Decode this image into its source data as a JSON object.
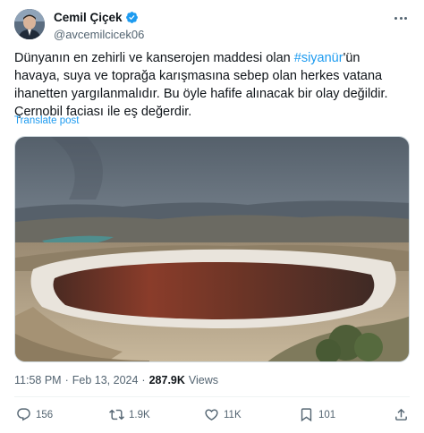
{
  "author": {
    "display_name": "Cemil Çiçek",
    "handle": "@avcemilcicek06",
    "verified": true
  },
  "tweet": {
    "text_before": "Dünyanın en zehirli ve kanserojen maddesi olan ",
    "hashtag": "#siyanür",
    "text_after": "'ün havaya, suya ve toprağa karışmasına sebep olan herkes vatana ihanetten yargılanmalıdır. Bu öyle hafife alınacak bir olay değildir. Çernobil faciası ile eş değerdir.",
    "translate_label": "Translate post"
  },
  "meta": {
    "time": "11:58 PM",
    "separator": "·",
    "date": "Feb 13, 2024",
    "views_count": "287.9K",
    "views_label": "Views"
  },
  "actions": {
    "reply_count": "156",
    "repost_count": "1.9K",
    "like_count": "11K",
    "bookmark_count": "101"
  },
  "icons": {
    "more": "more-horizontal-icon",
    "verified": "verified-badge-icon",
    "reply": "reply-icon",
    "repost": "repost-icon",
    "like": "heart-icon",
    "bookmark": "bookmark-icon",
    "share": "share-icon"
  },
  "colors": {
    "accent": "#1d9bf0",
    "text_primary": "#0f1419",
    "text_secondary": "#536471"
  }
}
